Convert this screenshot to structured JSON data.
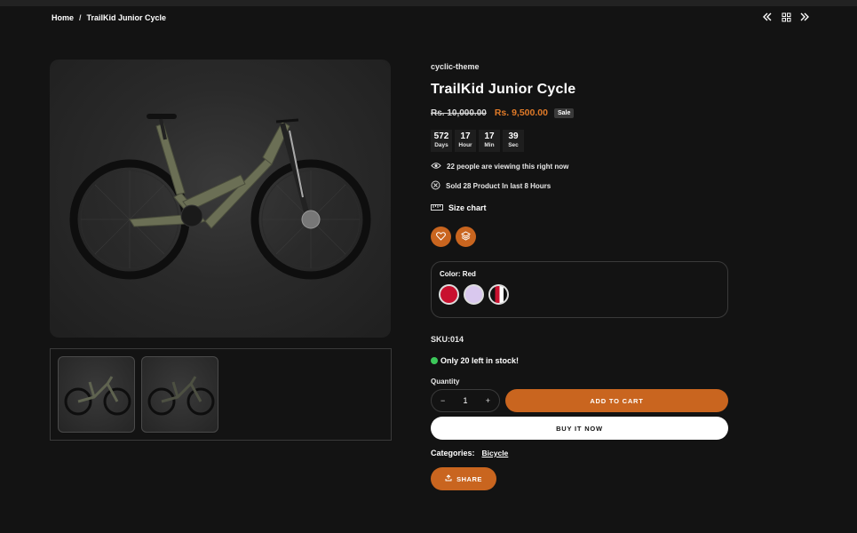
{
  "breadcrumb": {
    "home": "Home",
    "separator": "/",
    "current": "TrailKid Junior Cycle"
  },
  "topnav": {
    "icons": [
      "double-chevron-left-icon",
      "grid-icon",
      "double-chevron-right-icon"
    ]
  },
  "product": {
    "vendor": "cyclic-theme",
    "title": "TrailKid Junior Cycle",
    "old_price": "Rs. 10,000.00",
    "new_price": "Rs. 9,500.00",
    "sale_badge": "Sale",
    "countdown": [
      {
        "value": "572",
        "label": "Days"
      },
      {
        "value": "17",
        "label": "Hour"
      },
      {
        "value": "17",
        "label": "Min"
      },
      {
        "value": "39",
        "label": "Sec"
      }
    ],
    "viewing": "22 people are viewing this right now",
    "sold": "Sold 28 Product In last 8 Hours",
    "size_chart": "Size chart",
    "color": {
      "label": "Color:",
      "selected": "Red",
      "swatches": [
        "#c8102e",
        "#d9c8ee",
        "split-red-white"
      ]
    },
    "sku": "SKU:014",
    "stock": "Only 20 left in stock!",
    "quantity_label": "Quantity",
    "quantity": {
      "minus": "−",
      "value": "1",
      "plus": "+"
    },
    "add_to_cart": "ADD TO CART",
    "buy_now": "BUY IT NOW",
    "categories_label": "Categories:",
    "category": "Bicycle",
    "share": "SHARE"
  },
  "colors": {
    "accent": "#c9651f",
    "price": "#e07a28",
    "background": "#131313",
    "stock_dot": "#3cc85a"
  }
}
